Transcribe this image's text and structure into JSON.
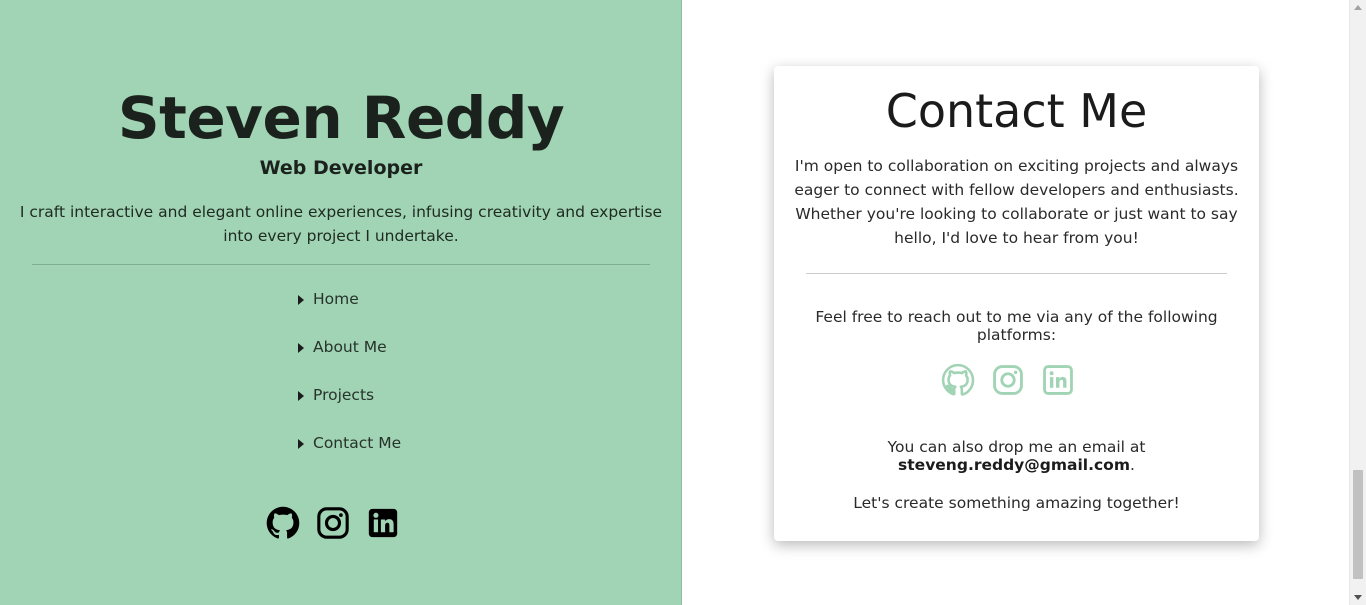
{
  "profile": {
    "name": "Steven Reddy",
    "role": "Web Developer",
    "intro": "I craft interactive and elegant online experiences, infusing creativity and expertise into every project I undertake."
  },
  "nav": {
    "items": [
      {
        "label": "Home"
      },
      {
        "label": "About Me"
      },
      {
        "label": "Projects"
      },
      {
        "label": "Contact Me"
      }
    ]
  },
  "socials": {
    "icons": [
      "github-icon",
      "instagram-icon",
      "linkedin-icon"
    ],
    "left_color": "#000000",
    "right_color": "#a0d4b4"
  },
  "contact": {
    "title": "Contact Me",
    "paragraph": "I'm open to collaboration on exciting projects and always eager to connect with fellow developers and enthusiasts. Whether you're looking to collaborate or just want to say hello, I'd love to hear from you!",
    "reach_text": "Feel free to reach out to me via any of the following platforms:",
    "email_prefix": "You can also drop me an email at ",
    "email": "steveng.reddy@gmail.com",
    "email_suffix": ".",
    "closing": "Let's create something amazing together!"
  },
  "colors": {
    "sidebar_bg": "#a0d4b4",
    "text_dark": "#1b1b1b",
    "card_bg": "#ffffff"
  }
}
